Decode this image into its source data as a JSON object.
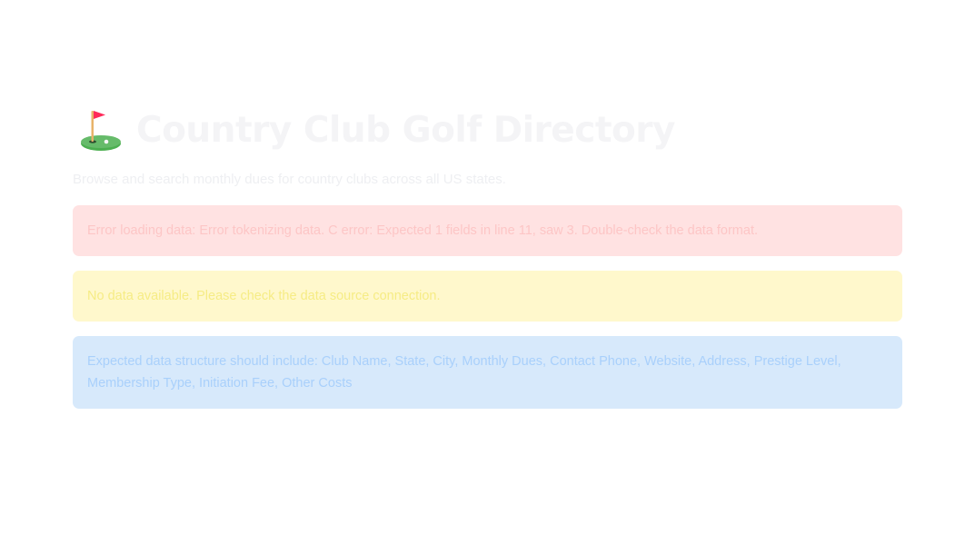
{
  "header": {
    "title": "Country Club Golf Directory",
    "subtitle": "Browse and search monthly dues for country clubs across all US states.",
    "icon": "golf-flag-icon"
  },
  "alerts": {
    "error": "Error loading data: Error tokenizing data. C error: Expected 1 fields in line 11, saw 3. Double-check the data format.",
    "warning": "No data available. Please check the data source connection.",
    "info": "Expected data structure should include: Club Name, State, City, Monthly Dues, Contact Phone, Website, Address, Prestige Level, Membership Type, Initiation Fee, Other Costs"
  },
  "colors": {
    "error_bg": "#ffe2e2",
    "warning_bg": "#fff8cc",
    "info_bg": "#d7e9fb"
  }
}
